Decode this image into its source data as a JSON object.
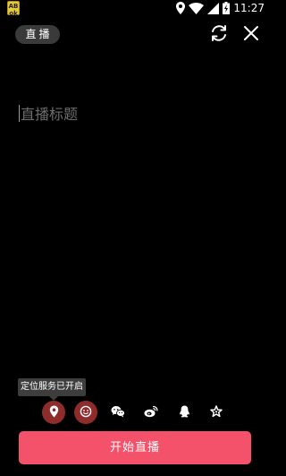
{
  "status_bar": {
    "app_badge_top": "AB",
    "app_badge_bottom": "ok",
    "time": "11:27",
    "icons": [
      "location-pin-icon",
      "wifi-icon",
      "signal-icon",
      "battery-charging-icon"
    ]
  },
  "header": {
    "live_tag": "直播",
    "switch_camera_icon": "switch-camera-icon",
    "close_icon": "close-icon"
  },
  "title_input": {
    "placeholder": "直播标题",
    "value": ""
  },
  "tooltip": {
    "text": "定位服务已开启"
  },
  "share_options": [
    {
      "name": "location",
      "icon": "location-pin-icon",
      "active": true
    },
    {
      "name": "beauty",
      "icon": "beauty-filter-icon",
      "active": true
    },
    {
      "name": "wechat",
      "icon": "wechat-icon",
      "active": false
    },
    {
      "name": "weibo",
      "icon": "weibo-icon",
      "active": false
    },
    {
      "name": "qq",
      "icon": "qq-icon",
      "active": false
    },
    {
      "name": "favorite",
      "icon": "star-icon",
      "active": false
    }
  ],
  "start_button": {
    "label": "开始直播"
  },
  "colors": {
    "background": "#000000",
    "accent": "#f4526a",
    "active_icon_bg": "#8e2b2b",
    "tag_bg": "#3a3a3a",
    "placeholder": "#6d6d6d"
  }
}
